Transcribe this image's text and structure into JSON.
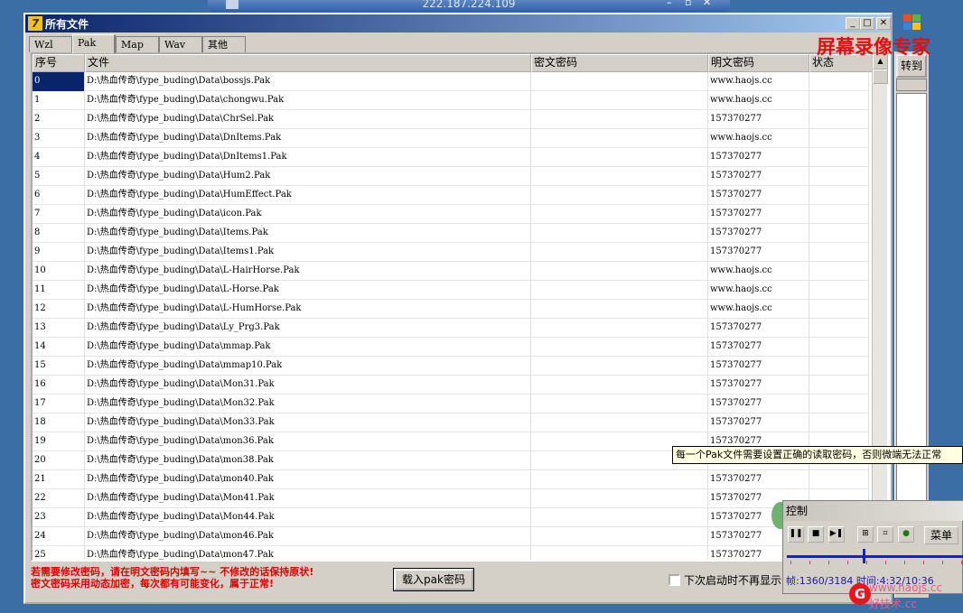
{
  "remote_bar": {
    "ip": "222.187.224.109"
  },
  "window": {
    "title": "所有文件"
  },
  "tabs": [
    {
      "label": "Wzl",
      "active": false
    },
    {
      "label": "Pak",
      "active": true
    },
    {
      "label": "Map",
      "active": false
    },
    {
      "label": "Wav",
      "active": false
    },
    {
      "label": "其他",
      "active": false
    }
  ],
  "columns": {
    "index": "序号",
    "file": "文件",
    "cipher": "密文密码",
    "plain": "明文密码",
    "status": "状态"
  },
  "rows": [
    {
      "idx": "0",
      "file": "D:\\热血传奇\\fype_buding\\Data\\bossjs.Pak",
      "plain": "www.haojs.cc"
    },
    {
      "idx": "1",
      "file": "D:\\热血传奇\\fype_buding\\Data\\chongwu.Pak",
      "plain": "www.haojs.cc"
    },
    {
      "idx": "2",
      "file": "D:\\热血传奇\\fype_buding\\Data\\ChrSel.Pak",
      "plain": "157370277"
    },
    {
      "idx": "3",
      "file": "D:\\热血传奇\\fype_buding\\Data\\DnItems.Pak",
      "plain": "www.haojs.cc"
    },
    {
      "idx": "4",
      "file": "D:\\热血传奇\\fype_buding\\Data\\DnItems1.Pak",
      "plain": "157370277"
    },
    {
      "idx": "5",
      "file": "D:\\热血传奇\\fype_buding\\Data\\Hum2.Pak",
      "plain": "157370277"
    },
    {
      "idx": "6",
      "file": "D:\\热血传奇\\fype_buding\\Data\\HumEffect.Pak",
      "plain": "157370277"
    },
    {
      "idx": "7",
      "file": "D:\\热血传奇\\fype_buding\\Data\\icon.Pak",
      "plain": "157370277"
    },
    {
      "idx": "8",
      "file": "D:\\热血传奇\\fype_buding\\Data\\Items.Pak",
      "plain": "157370277"
    },
    {
      "idx": "9",
      "file": "D:\\热血传奇\\fype_buding\\Data\\Items1.Pak",
      "plain": "157370277"
    },
    {
      "idx": "10",
      "file": "D:\\热血传奇\\fype_buding\\Data\\L-HairHorse.Pak",
      "plain": "www.haojs.cc"
    },
    {
      "idx": "11",
      "file": "D:\\热血传奇\\fype_buding\\Data\\L-Horse.Pak",
      "plain": "www.haojs.cc"
    },
    {
      "idx": "12",
      "file": "D:\\热血传奇\\fype_buding\\Data\\L-HumHorse.Pak",
      "plain": "www.haojs.cc"
    },
    {
      "idx": "13",
      "file": "D:\\热血传奇\\fype_buding\\Data\\Ly_Prg3.Pak",
      "plain": "157370277"
    },
    {
      "idx": "14",
      "file": "D:\\热血传奇\\fype_buding\\Data\\mmap.Pak",
      "plain": "157370277"
    },
    {
      "idx": "15",
      "file": "D:\\热血传奇\\fype_buding\\Data\\mmap10.Pak",
      "plain": "157370277"
    },
    {
      "idx": "16",
      "file": "D:\\热血传奇\\fype_buding\\Data\\Mon31.Pak",
      "plain": "157370277"
    },
    {
      "idx": "17",
      "file": "D:\\热血传奇\\fype_buding\\Data\\Mon32.Pak",
      "plain": "157370277"
    },
    {
      "idx": "18",
      "file": "D:\\热血传奇\\fype_buding\\Data\\Mon33.Pak",
      "plain": "157370277"
    },
    {
      "idx": "19",
      "file": "D:\\热血传奇\\fype_buding\\Data\\mon36.Pak",
      "plain": "157370277"
    },
    {
      "idx": "20",
      "file": "D:\\热血传奇\\fype_buding\\Data\\mon38.Pak",
      "plain": ""
    },
    {
      "idx": "21",
      "file": "D:\\热血传奇\\fype_buding\\Data\\mon40.Pak",
      "plain": "157370277"
    },
    {
      "idx": "22",
      "file": "D:\\热血传奇\\fype_buding\\Data\\Mon41.Pak",
      "plain": "157370277"
    },
    {
      "idx": "23",
      "file": "D:\\热血传奇\\fype_buding\\Data\\Mon44.Pak",
      "plain": "157370277"
    },
    {
      "idx": "24",
      "file": "D:\\热血传奇\\fype_buding\\Data\\mon46.Pak",
      "plain": "157370277"
    },
    {
      "idx": "25",
      "file": "D:\\热血传奇\\fype_buding\\Data\\mon47.Pak",
      "plain": "157370277"
    }
  ],
  "notice": {
    "line1": "若需要修改密码，请在明文密码内填写~~ 不修改的话保持原状!",
    "line2": "密文密码采用动态加密，每次都有可能变化，属于正常!"
  },
  "load_button": "载入pak密码",
  "checkbox_label": "下次启动时不再显示",
  "tooltip": "每一个Pak文件需要设置正确的读取密码，否则微端无法正常",
  "side": {
    "goto_label": "转到",
    "watermark": "屏幕录像专家"
  },
  "recorder": {
    "title": "控制",
    "menu_label": "菜单",
    "frame_info": "帧:1360/3184 时间:4:32/10:36",
    "progress": 0.427
  },
  "watermark_bottom": {
    "url": "www.haojs.cc",
    "name": "好技术.cc"
  },
  "colors": {
    "title_bar": "#0a246a",
    "desktop": "#3a6ea5",
    "notice": "#e00000",
    "selection": "#0a246a"
  }
}
